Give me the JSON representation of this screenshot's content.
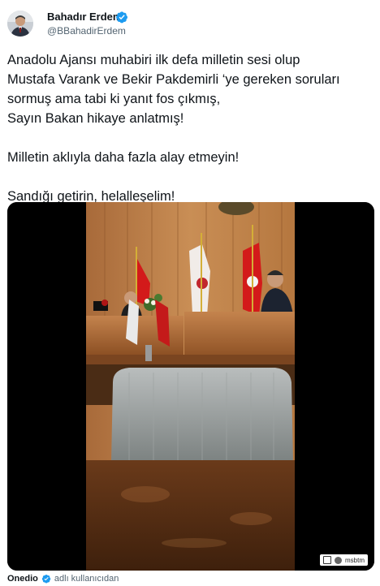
{
  "author": {
    "display_name": "Bahadır Erdem",
    "handle": "@BBahadirErdem",
    "avatar_icon": "profile-photo",
    "verified_icon": "verified-badge-icon"
  },
  "tweet": {
    "lines_paragraph_1": [
      "Anadolu Ajansı muhabiri ilk defa milletin sesi olup",
      "Mustafa Varank ve Bekir Pakdemirli ‘ye gereken soruları",
      "sormuş ama tabi ki yanıt fos çıkmış,",
      "Sayın Bakan hikaye anlatmış!"
    ],
    "paragraph_2": "Milletin aklıyla daha fazla alay etmeyin!",
    "paragraph_3": "Sandığı getirin, helalleşelim!"
  },
  "media": {
    "watermark_text": "msbtm"
  },
  "footer": {
    "source_name": "Onedio",
    "note": "adlı kullanıcıdan"
  },
  "colors": {
    "verified_blue": "#1d9bf0",
    "text_primary": "#0f1419",
    "text_secondary": "#536471"
  }
}
